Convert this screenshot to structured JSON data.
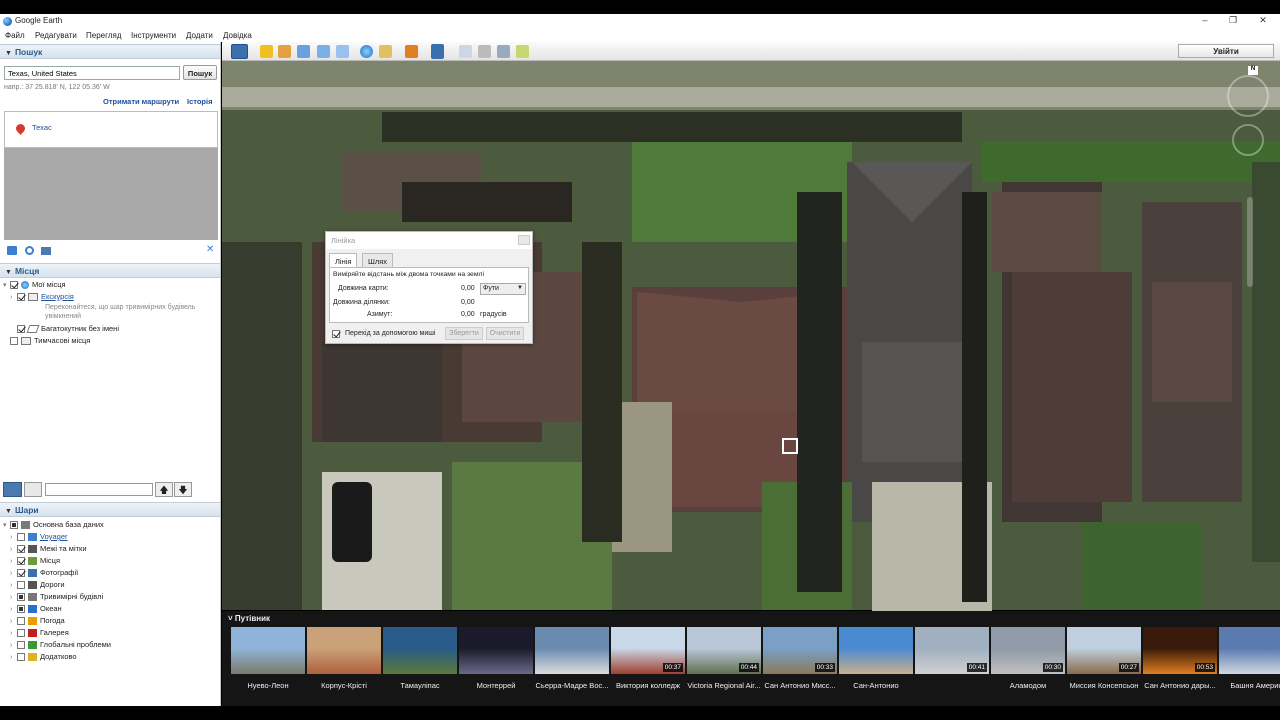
{
  "window": {
    "title": "Google Earth",
    "controls": [
      "–",
      "❐",
      "✕"
    ]
  },
  "menu": [
    "Файл",
    "Редагувати",
    "Перегляд",
    "Інструменти",
    "Додати",
    "Довідка"
  ],
  "search": {
    "header": "Пошук",
    "value": "Texas, United States",
    "button": "Пошук",
    "coords": "напр.: 37 25.818' N, 122 05.36' W",
    "route_link": "Отримати маршрути",
    "history_link": "Історія",
    "result": "Техас"
  },
  "places": {
    "header": "Місця",
    "items": [
      {
        "label": "Мої місця",
        "checked": "on",
        "icon": "globe-icon"
      },
      {
        "label": "Екскурсія",
        "checked": "on",
        "icon": "folder-icon",
        "note": "Переконайтеся, що шар тривимірних будівель увімкнений"
      },
      {
        "label": "Багатокутник без імені",
        "checked": "on",
        "icon": "polygon-icon"
      },
      {
        "label": "Тимчасові місця",
        "checked": "off",
        "icon": "folder-icon"
      }
    ]
  },
  "layers": {
    "header": "Шари",
    "items": [
      {
        "label": "Основна база даних",
        "checked": "part",
        "color": "#7a7a7a",
        "link": false
      },
      {
        "label": "Voyager",
        "checked": "off",
        "color": "#3a7fd0",
        "link": true
      },
      {
        "label": "Межі та мітки",
        "checked": "on",
        "color": "#555555",
        "link": false
      },
      {
        "label": "Місця",
        "checked": "on",
        "color": "#6b9b3a",
        "link": false
      },
      {
        "label": "Фотографії",
        "checked": "on",
        "color": "#3a6fb0",
        "link": false
      },
      {
        "label": "Дороги",
        "checked": "off",
        "color": "#555555",
        "link": false
      },
      {
        "label": "Тривимірні будівлі",
        "checked": "part",
        "color": "#777777",
        "link": false
      },
      {
        "label": "Океан",
        "checked": "part",
        "color": "#2a70c8",
        "link": false
      },
      {
        "label": "Погода",
        "checked": "off",
        "color": "#e8a000",
        "link": false
      },
      {
        "label": "Галерея",
        "checked": "off",
        "color": "#c02020",
        "link": false
      },
      {
        "label": "Глобальні проблеми",
        "checked": "off",
        "color": "#3a9a3a",
        "link": false
      },
      {
        "label": "Додатково",
        "checked": "off",
        "color": "#e0b020",
        "link": false
      }
    ]
  },
  "toolbar": {
    "signin": "Увійти"
  },
  "ruler": {
    "title": "Лінійка",
    "tabs": [
      "Лінія",
      "Шлях"
    ],
    "instruction": "Виміряйте відстань між двома точками на землі",
    "map_length_label": "Довжина карти:",
    "map_length_value": "0,00",
    "units": "Фути",
    "ground_length_label": "Довжина ділянки:",
    "ground_length_value": "0,00",
    "heading_label": "Азимут:",
    "heading_value": "0,00",
    "heading_unit": "градусів",
    "mouse_nav_label": "Перехід за допомогою миші",
    "save_button": "Зберегти",
    "clear_button": "Очистити"
  },
  "tour": {
    "header": "Путівник",
    "items": [
      {
        "label": "Нуево-Леон",
        "duration": "",
        "c1": "#8fb3d9",
        "c2": "#7a7a6a"
      },
      {
        "label": "Корпус-Крісті",
        "duration": "",
        "c1": "#c9a27a",
        "c2": "#b0603a"
      },
      {
        "label": "Тамауліпас",
        "duration": "",
        "c1": "#2a5a8a",
        "c2": "#5a7a3a"
      },
      {
        "label": "Монтеррей",
        "duration": "",
        "c1": "#1a1a2a",
        "c2": "#6a6a8a"
      },
      {
        "label": "Сьерра-Мадре Вос...",
        "duration": "",
        "c1": "#6a8ab0",
        "c2": "#dcdcdc"
      },
      {
        "label": "Виктория колледж",
        "duration": "00:37",
        "c1": "#c8d8e8",
        "c2": "#a04030"
      },
      {
        "label": "Victoria Regional Air...",
        "duration": "00:44",
        "c1": "#b8c8d8",
        "c2": "#607050"
      },
      {
        "label": "Сан Антонио Мисс...",
        "duration": "00:33",
        "c1": "#7aa0c8",
        "c2": "#8a7a5a"
      },
      {
        "label": "Сан-Антонио",
        "duration": "",
        "c1": "#4a8ad0",
        "c2": "#c8b090"
      },
      {
        "label": "",
        "duration": "00:41",
        "c1": "#a0b0c0",
        "c2": "#d0d0d0"
      },
      {
        "label": "Аламодом",
        "duration": "00:30",
        "c1": "#909aa8",
        "c2": "#c0c0c0"
      },
      {
        "label": "Миссия Консепсьон",
        "duration": "00:27",
        "c1": "#c0d0e0",
        "c2": "#8a6a4a"
      },
      {
        "label": "Сан Антонио дары...",
        "duration": "00:53",
        "c1": "#3a1a0a",
        "c2": "#e08020"
      },
      {
        "label": "Башня Америк",
        "duration": "",
        "c1": "#5a7ab0",
        "c2": "#d0d8e0"
      }
    ]
  }
}
